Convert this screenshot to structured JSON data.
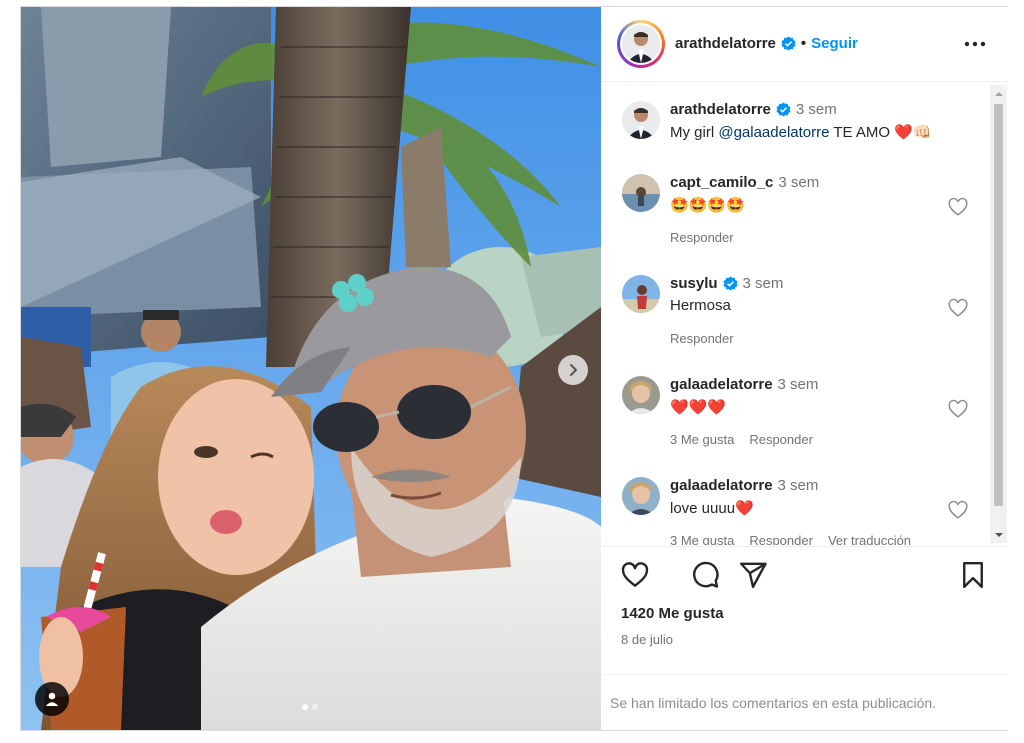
{
  "post": {
    "image_alt": "Selfie photo",
    "carousel_dots": 2
  },
  "header": {
    "username": "arathdelatorre",
    "separator": "•",
    "follow_label": "Seguir"
  },
  "comments": [
    {
      "username": "arathdelatorre",
      "verified": true,
      "time": "3 sem",
      "text_prefix": "My girl ",
      "mention": "@galaadelatorre",
      "text_suffix": " TE AMO ❤️👊🏻",
      "actions": []
    },
    {
      "username": "capt_camilo_c",
      "verified": false,
      "time": "3 sem",
      "text": "🤩🤩🤩🤩",
      "actions": [
        "Responder"
      ]
    },
    {
      "username": "susylu",
      "verified": true,
      "time": "3 sem",
      "text": "Hermosa",
      "actions": [
        "Responder"
      ]
    },
    {
      "username": "galaadelatorre",
      "verified": false,
      "time": "3 sem",
      "text": "❤️❤️❤️",
      "actions": [
        "3 Me gusta",
        "Responder"
      ]
    },
    {
      "username": "galaadelatorre",
      "verified": false,
      "time": "3 sem",
      "text": "love uuuu❤️",
      "actions": [
        "3 Me gusta",
        "Responder",
        "Ver traducción"
      ]
    }
  ],
  "footer": {
    "likes": "1420 Me gusta",
    "date": "8 de julio",
    "comments_limited": "Se han limitado los comentarios en esta publicación."
  },
  "colors": {
    "link_blue": "#0095f6",
    "verified_blue": "#0095f6",
    "muted_text": "#737373",
    "border": "#dbdbdb"
  },
  "icons": {
    "like": "heart-icon",
    "comment": "comment-icon",
    "share": "paper-plane-icon",
    "save": "bookmark-icon",
    "more": "more-dots-icon",
    "next": "chevron-right-icon",
    "tag": "user-tag-icon"
  }
}
